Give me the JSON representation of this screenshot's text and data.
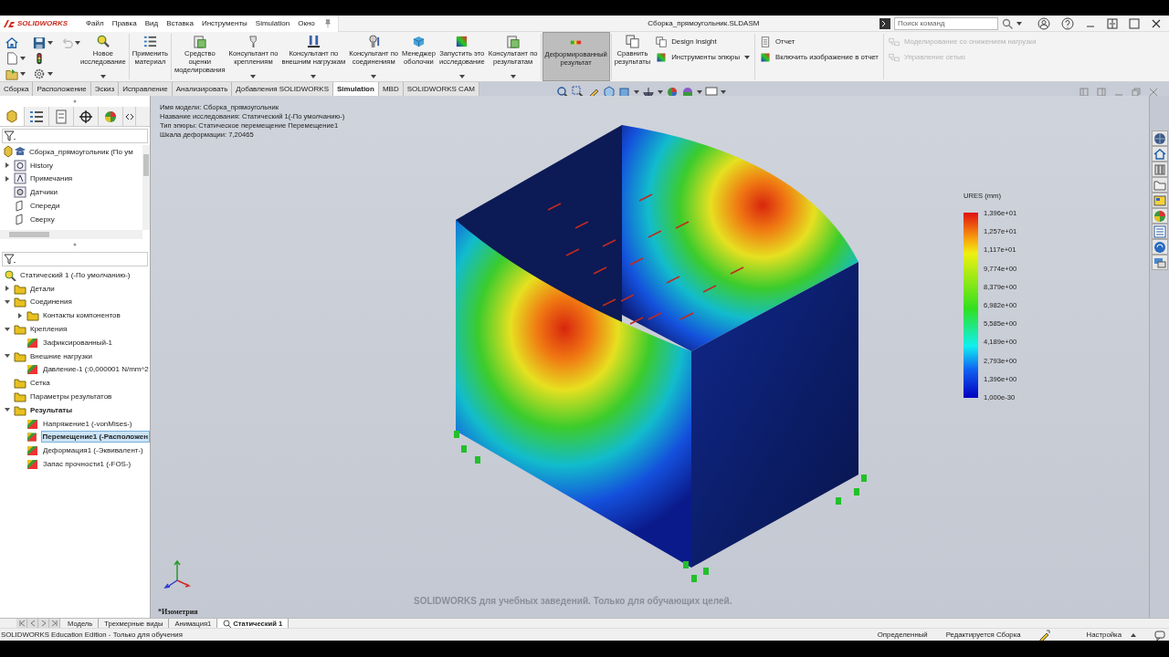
{
  "app": {
    "logo": "SOLIDWORKS"
  },
  "menu": [
    "Файл",
    "Правка",
    "Вид",
    "Вставка",
    "Инструменты",
    "Simulation",
    "Окно"
  ],
  "window": {
    "title": "Сборка_прямоугольник.SLDASM"
  },
  "search": {
    "placeholder": "Поиск команд"
  },
  "ribbon": {
    "buttons": [
      {
        "label": "Новое\nисследование",
        "dropdown": true,
        "selected": false
      },
      {
        "label": "Применить\nматериал",
        "dropdown": false,
        "selected": false
      },
      {
        "label": "Средство\nоценки\nмоделирования",
        "dropdown": false,
        "selected": false
      },
      {
        "label": "Консультант по\nкреплениям",
        "dropdown": true,
        "selected": false
      },
      {
        "label": "Консультант по\nвнешним нагрузкам",
        "dropdown": true,
        "selected": false
      },
      {
        "label": "Консультант по\nсоединениям",
        "dropdown": true,
        "selected": false
      },
      {
        "label": "Менеджер\nоболочки",
        "dropdown": false,
        "selected": false
      },
      {
        "label": "Запустить это\nисследование",
        "dropdown": true,
        "selected": false
      },
      {
        "label": "Консультант по\nрезультатам",
        "dropdown": true,
        "selected": false
      },
      {
        "label": "Деформированный\nрезультат",
        "dropdown": false,
        "selected": true
      },
      {
        "label": "Сравнить\nрезультаты",
        "dropdown": false,
        "selected": false
      }
    ],
    "small_groups": [
      [
        {
          "label": "Design Insight",
          "dropdown": false,
          "disabled": false
        },
        {
          "label": "Инструменты эпюры",
          "dropdown": true,
          "disabled": false
        }
      ],
      [
        {
          "label": "Отчет",
          "dropdown": false,
          "disabled": false
        },
        {
          "label": "Включить изображение в отчет",
          "dropdown": false,
          "disabled": false
        }
      ],
      [
        {
          "label": "Моделирование со снижением нагрузки",
          "dropdown": false,
          "disabled": true
        },
        {
          "label": "Управление сетью",
          "dropdown": false,
          "disabled": true
        }
      ]
    ]
  },
  "command_tabs": [
    {
      "label": "Сборка",
      "selected": false
    },
    {
      "label": "Расположение",
      "selected": false
    },
    {
      "label": "Эскиз",
      "selected": false
    },
    {
      "label": "Исправление",
      "selected": false
    },
    {
      "label": "Анализировать",
      "selected": false
    },
    {
      "label": "Добавления SOLIDWORKS",
      "selected": false
    },
    {
      "label": "Simulation",
      "selected": true
    },
    {
      "label": "MBD",
      "selected": false
    },
    {
      "label": "SOLIDWORKS CAM",
      "selected": false
    }
  ],
  "feature_tree": {
    "root": "Сборка_прямоугольник  (По ум",
    "panel_tabs": [
      {
        "selected": true
      },
      {
        "selected": false
      },
      {
        "selected": false
      },
      {
        "selected": false
      },
      {
        "selected": false
      }
    ],
    "items": [
      {
        "label": "History",
        "expanded": false
      },
      {
        "label": "Примечания",
        "expanded": false
      },
      {
        "label": "Датчики"
      },
      {
        "label": "Спереди"
      },
      {
        "label": "Сверху"
      }
    ]
  },
  "study_tree": {
    "root": "Статический 1 (-По умолчанию-)",
    "items": [
      {
        "label": "Детали",
        "expanded": false,
        "selected": false
      },
      {
        "label": "Соединения",
        "expanded": true,
        "selected": false,
        "children": [
          {
            "label": "Контакты компонентов",
            "expanded": false,
            "selected": false
          }
        ]
      },
      {
        "label": "Крепления",
        "expanded": true,
        "selected": false,
        "children": [
          {
            "label": "Зафиксированный-1",
            "selected": false
          }
        ]
      },
      {
        "label": "Внешние нагрузки",
        "expanded": true,
        "selected": false,
        "children": [
          {
            "label": "Давление-1 (:0,000001 N/mm^2",
            "selected": false
          }
        ]
      },
      {
        "label": "Сетка",
        "selected": false
      },
      {
        "label": "Параметры результатов",
        "selected": false
      },
      {
        "label": "Результаты",
        "expanded": true,
        "selected": false,
        "bold": true,
        "children": [
          {
            "label": "Напряжение1 (-vonMises-)",
            "selected": false
          },
          {
            "label": "Перемещение1 (-Расположен",
            "selected": true
          },
          {
            "label": "Деформация1 (-Эквивалент-)",
            "selected": false
          },
          {
            "label": "Запас прочности1 (-FOS-)",
            "selected": false
          }
        ]
      }
    ]
  },
  "viewport": {
    "info": [
      "Имя модели: Сборка_прямоугольник",
      "Название исследования: Статический 1(-По умолчанию-)",
      "Тип эпюры: Статическое перемещение Перемещение1",
      "Шкала деформации: 7,20465"
    ],
    "legend": {
      "title": "URES (mm)",
      "labels": [
        "1,396e+01",
        "1,257e+01",
        "1,117e+01",
        "9,774e+00",
        "8,379e+00",
        "6,982e+00",
        "5,585e+00",
        "4,189e+00",
        "2,793e+00",
        "1,396e+00",
        "1,000e-30"
      ]
    },
    "view_name": "*Изометрия",
    "watermark": "SOLIDWORKS для учебных заведений. Только для обучающих целей."
  },
  "bottom_tabs": [
    {
      "label": "Модель",
      "selected": false
    },
    {
      "label": "Трехмерные виды",
      "selected": false
    },
    {
      "label": "Анимация1",
      "selected": false
    },
    {
      "label": "Статический 1",
      "selected": true
    }
  ],
  "status_bar": {
    "left": "SOLIDWORKS Education Edition - Только для обучения",
    "items": [
      "Определенный",
      "Редактируется Сборка"
    ],
    "settings": "Настройка"
  }
}
